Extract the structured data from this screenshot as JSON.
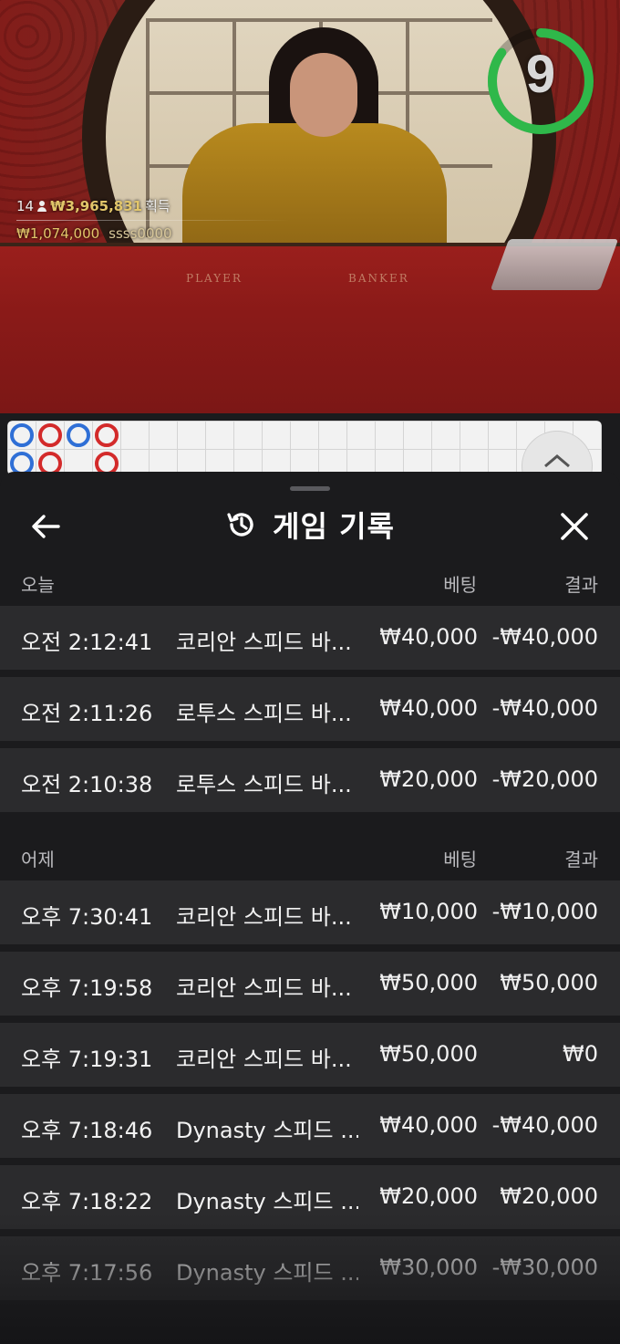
{
  "video": {
    "timer": "9",
    "timer_fraction": 0.85,
    "winners": {
      "count": "14",
      "total": "₩3,965,831",
      "total_suffix": "획득",
      "top_amount": "₩1,074,000",
      "top_user": "ssss0000"
    },
    "table_labels": {
      "player": "PLAYER",
      "banker": "BANKER"
    }
  },
  "roadmap": {
    "beads": [
      "blue",
      "red",
      "blue",
      "red",
      "blue",
      "red",
      "",
      "red"
    ]
  },
  "sheet": {
    "title": "게임 기록",
    "sections": [
      {
        "day": "오늘",
        "bet_header": "베팅",
        "result_header": "결과",
        "rows": [
          {
            "time": "오전 2:12:41",
            "game": "코리안 스피드 바...",
            "bet": "₩40,000",
            "result": "-₩40,000"
          },
          {
            "time": "오전 2:11:26",
            "game": "로투스 스피드 바...",
            "bet": "₩40,000",
            "result": "-₩40,000"
          },
          {
            "time": "오전 2:10:38",
            "game": "로투스 스피드 바...",
            "bet": "₩20,000",
            "result": "-₩20,000"
          }
        ]
      },
      {
        "day": "어제",
        "bet_header": "베팅",
        "result_header": "결과",
        "rows": [
          {
            "time": "오후 7:30:41",
            "game": "코리안 스피드 바...",
            "bet": "₩10,000",
            "result": "-₩10,000"
          },
          {
            "time": "오후 7:19:58",
            "game": "코리안 스피드 바...",
            "bet": "₩50,000",
            "result": "₩50,000"
          },
          {
            "time": "오후 7:19:31",
            "game": "코리안 스피드 바...",
            "bet": "₩50,000",
            "result": "₩0"
          },
          {
            "time": "오후 7:18:46",
            "game": "Dynasty 스피드 ...",
            "bet": "₩40,000",
            "result": "-₩40,000"
          },
          {
            "time": "오후 7:18:22",
            "game": "Dynasty 스피드 ...",
            "bet": "₩20,000",
            "result": "₩20,000"
          },
          {
            "time": "오후 7:17:56",
            "game": "Dynasty 스피드 ...",
            "bet": "₩30,000",
            "result": "-₩30,000"
          }
        ]
      }
    ]
  },
  "colors": {
    "timer_ring": "#2fb84a",
    "sheet_bg": "#1b1b1d",
    "row_bg": "#2b2b2d",
    "win_amount": "#e2c66a"
  }
}
